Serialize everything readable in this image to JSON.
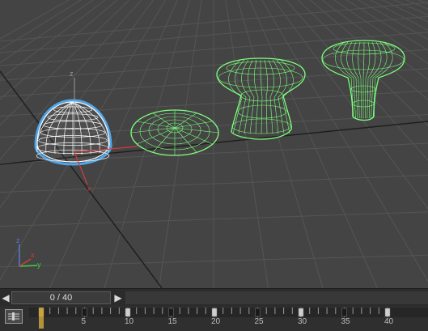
{
  "timeline": {
    "frame_display": "0 / 40",
    "current_frame": 0,
    "frame_start": 0,
    "frame_end": 40,
    "ruler_labels": [
      "5",
      "10",
      "15",
      "20",
      "25",
      "30",
      "35",
      "40"
    ]
  },
  "viewport": {
    "gizmo_axes": {
      "x": "x",
      "y": "y",
      "z": "z"
    },
    "world_axes": {
      "x": "x",
      "y": "y",
      "z": "z"
    }
  },
  "icons": {
    "prev_frame": "chevron-left-icon",
    "next_frame": "chevron-right-icon",
    "key_filter": "key-filter-icon"
  },
  "colors": {
    "viewport_bg": "#444444",
    "grid": "#555555",
    "wireframe_selected": "#ffffff",
    "wireframe_green": "#7dff7d",
    "highlight_blue": "#4fa6e8",
    "axis_x": "#d23c3c",
    "axis_y": "#3cd23c",
    "axis_z": "#5a7ad2"
  }
}
